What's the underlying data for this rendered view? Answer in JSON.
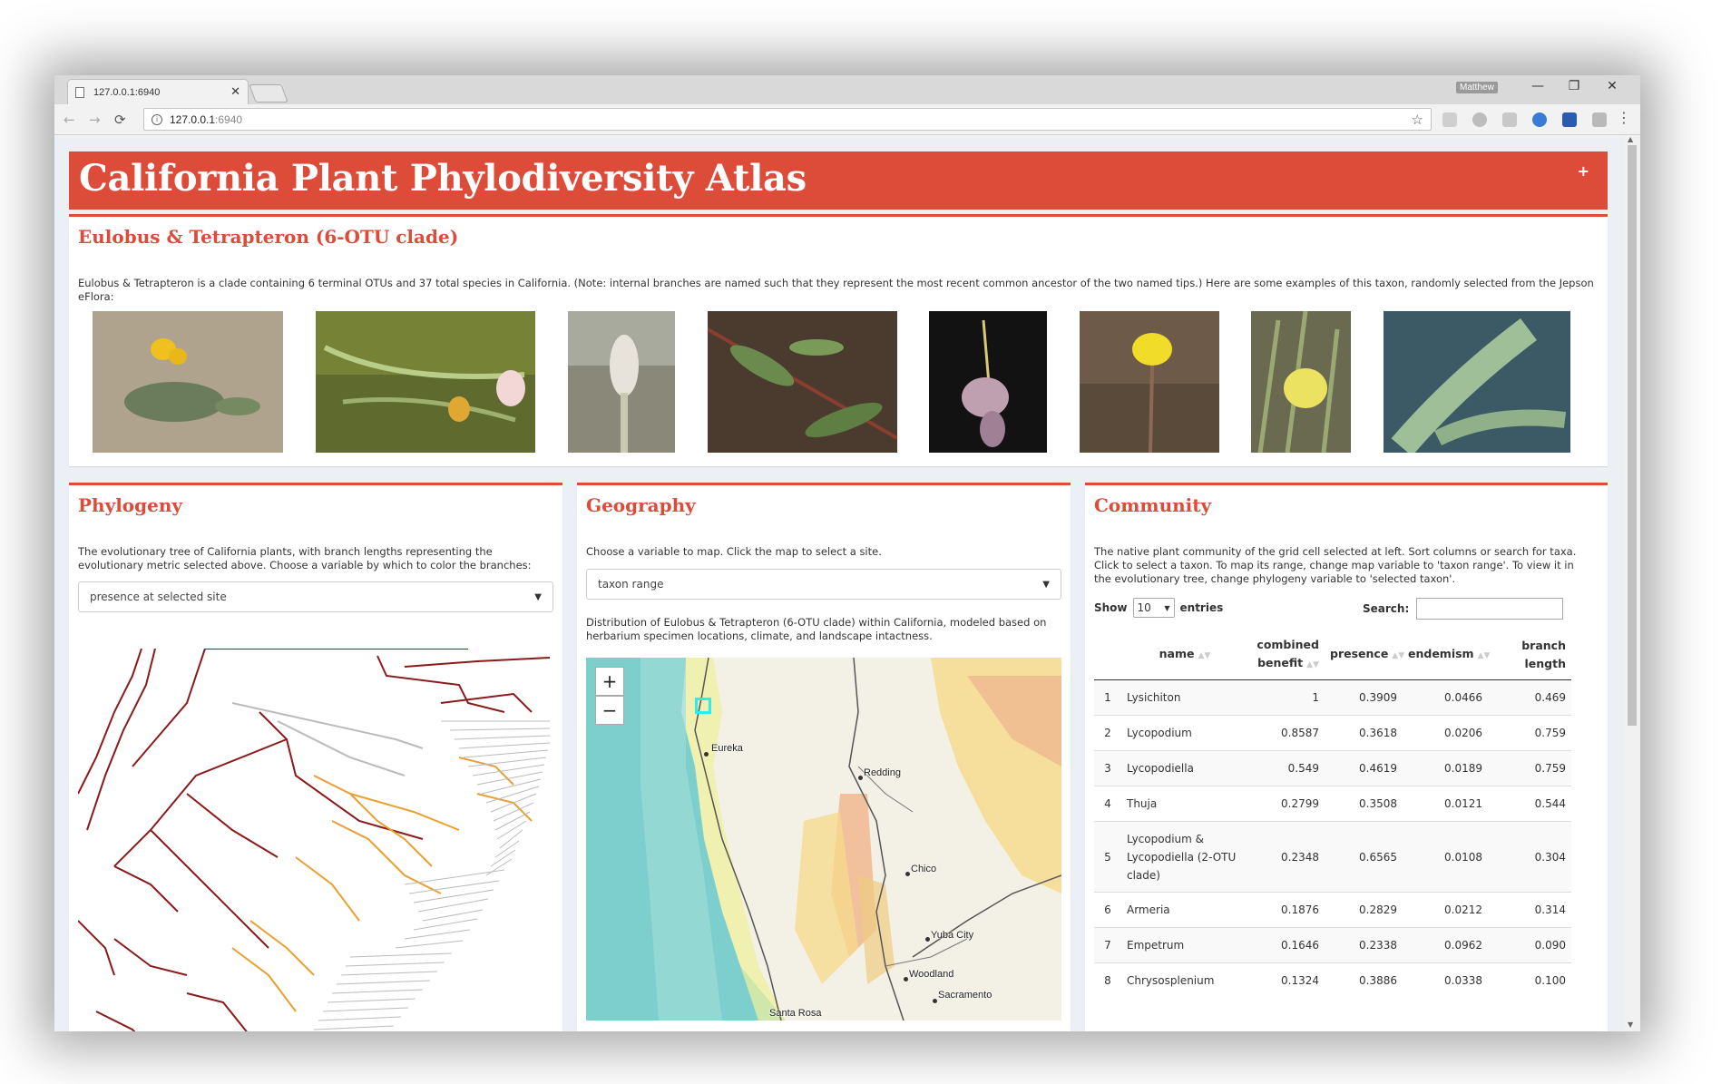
{
  "browser": {
    "tab_title": "127.0.0.1:6940",
    "tab_close": "✕",
    "user": "Matthew",
    "min": "—",
    "max": "❐",
    "close": "✕",
    "back": "←",
    "forward": "→",
    "reload": "⟳",
    "url_host": "127.0.0.1",
    "url_port": ":6940",
    "star": "☆",
    "menu": "⋮"
  },
  "header": {
    "title": "California Plant Phylodiversity Atlas",
    "toggle": "+"
  },
  "clade": {
    "title": "Eulobus & Tetrapteron (6-OTU clade)",
    "description": "Eulobus & Tetrapteron is a clade containing 6 terminal OTUs and 37 total species in California. (Note: internal branches are named such that they represent the most recent common ancestor of the two named tips.) Here are some examples of this taxon, randomly selected from the Jepson eFlora:"
  },
  "phylogeny": {
    "title": "Phylogeny",
    "description": "The evolutionary tree of California plants, with branch lengths representing the evolutionary metric selected above. Choose a variable by which to color the branches:",
    "selected": "presence at selected site",
    "caret": "▼"
  },
  "geography": {
    "title": "Geography",
    "description": "Choose a variable to map. Click the map to select a site.",
    "selected": "taxon range",
    "caret": "▼",
    "map_caption": "Distribution of Eulobus & Tetrapteron (6-OTU clade) within California, modeled based on herbarium specimen locations, climate, and landscape intactness.",
    "zoom_in": "+",
    "zoom_out": "−",
    "cities": [
      "Eureka",
      "Redding",
      "Chico",
      "Yuba City",
      "Woodland",
      "Sacramento",
      "Santa Rosa"
    ]
  },
  "community": {
    "title": "Community",
    "description": "The native plant community of the grid cell selected at left. Sort columns or search for taxa. Click to select a taxon. To map its range, change map variable to 'taxon range'. To view it in the evolutionary tree, change phylogeny variable to 'selected taxon'.",
    "show_label": "Show",
    "show_value": "10",
    "entries_label": "entries",
    "search_label": "Search:",
    "columns": [
      "",
      "name",
      "combined benefit",
      "presence",
      "endemism",
      "branch length"
    ],
    "rows": [
      [
        "1",
        "Lysichiton",
        "1",
        "0.3909",
        "0.0466",
        "0.469"
      ],
      [
        "2",
        "Lycopodium",
        "0.8587",
        "0.3618",
        "0.0206",
        "0.759"
      ],
      [
        "3",
        "Lycopodiella",
        "0.549",
        "0.4619",
        "0.0189",
        "0.759"
      ],
      [
        "4",
        "Thuja",
        "0.2799",
        "0.3508",
        "0.0121",
        "0.544"
      ],
      [
        "5",
        "Lycopodium & Lycopodiella (2-OTU clade)",
        "0.2348",
        "0.6565",
        "0.0108",
        "0.304"
      ],
      [
        "6",
        "Armeria",
        "0.1876",
        "0.2829",
        "0.0212",
        "0.314"
      ],
      [
        "7",
        "Empetrum",
        "0.1646",
        "0.2338",
        "0.0962",
        "0.090"
      ],
      [
        "8",
        "Chrysosplenium",
        "0.1324",
        "0.3886",
        "0.0338",
        "0.100"
      ]
    ]
  },
  "colors": {
    "accent": "#dd4b39",
    "dark_branch": "#8b1a1a",
    "orange_branch": "#e8a030",
    "grey_branch": "#bbbbbb"
  }
}
